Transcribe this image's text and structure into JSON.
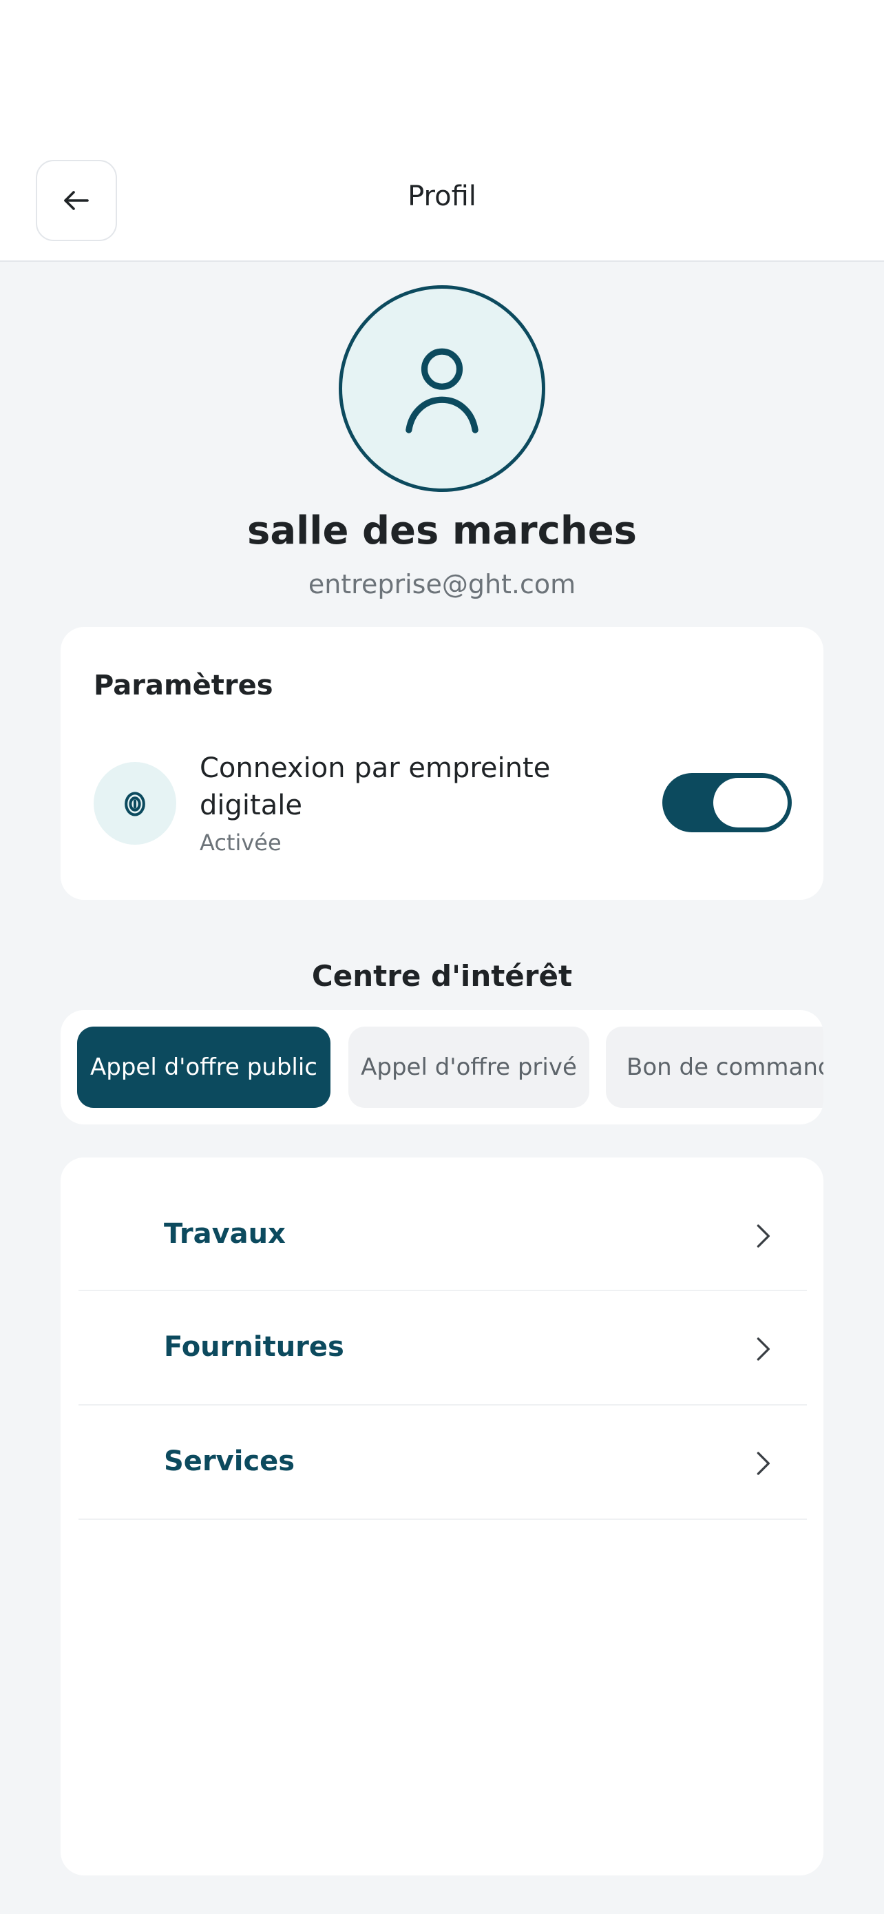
{
  "header": {
    "title": "Profil"
  },
  "profile": {
    "name": "salle des marches",
    "email": "entreprise@ght.com"
  },
  "settings": {
    "title": "Paramètres",
    "fingerprint": {
      "label": "Connexion par empreinte digitale",
      "status": "Activée",
      "enabled": true
    }
  },
  "interests": {
    "title": "Centre d'intérêt",
    "tabs": [
      {
        "label": "Appel d'offre public",
        "active": true
      },
      {
        "label": "Appel d'offre privé",
        "active": false
      },
      {
        "label": "Bon de commande",
        "active": false
      }
    ],
    "items": [
      {
        "label": "Travaux"
      },
      {
        "label": "Fournitures"
      },
      {
        "label": "Services"
      }
    ]
  },
  "colors": {
    "primary": "#0c4a5e",
    "avatar_bg": "#e6f3f4",
    "background": "#f3f5f7"
  }
}
